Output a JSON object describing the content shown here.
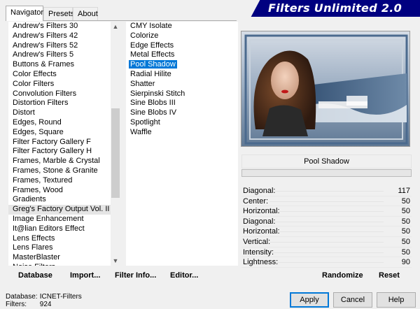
{
  "tabs": [
    {
      "label": "Navigator",
      "active": true
    },
    {
      "label": "Presets",
      "active": false
    },
    {
      "label": "About",
      "active": false
    }
  ],
  "banner": {
    "title": "Filters Unlimited 2.0"
  },
  "categories": [
    "Andrew's Filters 30",
    "Andrew's Filters 42",
    "Andrew's Filters 52",
    "Andrew's Filters 5",
    "Buttons & Frames",
    "Color Effects",
    "Color Filters",
    "Convolution Filters",
    "Distortion Filters",
    "Distort",
    "Edges, Round",
    "Edges, Square",
    "Filter Factory Gallery F",
    "Filter Factory Gallery H",
    "Frames, Marble & Crystal",
    "Frames, Stone & Granite",
    "Frames, Textured",
    "Frames, Wood",
    "Gradients",
    "Greg's Factory Output Vol. II",
    "Image Enhancement",
    "It@lian Editors Effect",
    "Lens Effects",
    "Lens Flares",
    "MasterBlaster",
    "Noise Filters"
  ],
  "filters": [
    "CMY Isolate",
    "Colorize",
    "Edge Effects",
    "Metal Effects",
    "Pool Shadow",
    "Radial Hilite",
    "Shatter",
    "Sierpinski Stitch",
    "Sine Blobs III",
    "Sine Blobs IV",
    "Spotlight",
    "Waffle"
  ],
  "selected_filter": "Pool Shadow",
  "list_buttons": {
    "database": "Database",
    "import": "Import...",
    "filter_info": "Filter Info...",
    "editor": "Editor..."
  },
  "effect_name": "Pool Shadow",
  "params": [
    {
      "label": "Diagonal:",
      "value": "117"
    },
    {
      "label": "Center:",
      "value": "50"
    },
    {
      "label": "Horizontal:",
      "value": "50"
    },
    {
      "label": "Diagonal:",
      "value": "50"
    },
    {
      "label": "Horizontal:",
      "value": "50"
    },
    {
      "label": "Vertical:",
      "value": "50"
    },
    {
      "label": "Intensity:",
      "value": "50"
    },
    {
      "label": "Lightness:",
      "value": "90"
    }
  ],
  "actions": {
    "randomize": "Randomize",
    "reset": "Reset"
  },
  "status": {
    "database_label": "Database:",
    "database_value": "ICNET-Filters",
    "filters_label": "Filters:",
    "filters_value": "924"
  },
  "dialog_buttons": {
    "apply": "Apply",
    "cancel": "Cancel",
    "help": "Help"
  },
  "colors": {
    "accent": "#0078d7",
    "banner": "#000080"
  }
}
